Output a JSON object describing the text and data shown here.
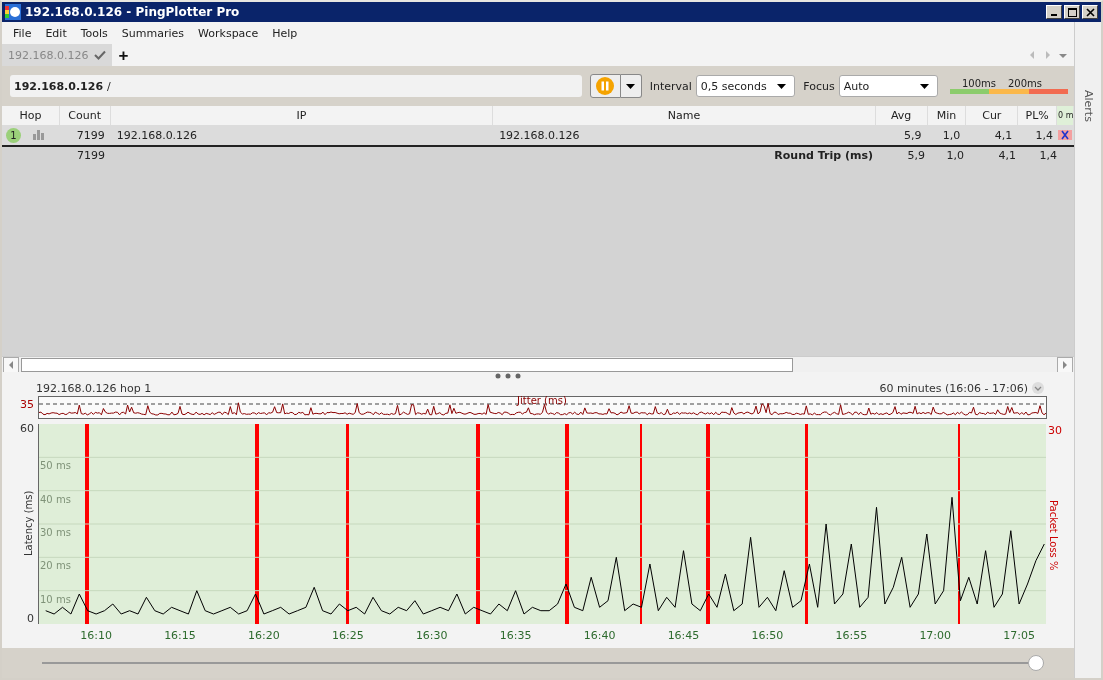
{
  "window": {
    "title": "192.168.0.126 - PingPlotter Pro"
  },
  "menu": [
    "File",
    "Edit",
    "Tools",
    "Summaries",
    "Workspace",
    "Help"
  ],
  "tabs": [
    {
      "label": "192.168.0.126",
      "selected": true
    }
  ],
  "new_tab": "+",
  "toolbar": {
    "target": "192.168.0.126",
    "target_suffix": "/",
    "interval_label": "Interval",
    "interval": "0,5 seconds",
    "focus_label": "Focus",
    "focus": "Auto",
    "scale_labels": [
      "100ms",
      "200ms"
    ]
  },
  "table": {
    "columns": [
      "Hop",
      "Count",
      "IP",
      "Name",
      "Avg",
      "Min",
      "Cur",
      "PL%",
      "0 m"
    ],
    "rows": [
      {
        "hop": "1",
        "count": "7199",
        "ip": "192.168.0.126",
        "name": "192.168.0.126",
        "avg": "5,9",
        "min": "1,0",
        "cur": "4,1",
        "pl": "1,4"
      }
    ],
    "summary": {
      "count": "7199",
      "label": "Round Trip (ms)",
      "avg": "5,9",
      "min": "1,0",
      "cur": "4,1",
      "pl": "1,4"
    }
  },
  "graph": {
    "title": "192.168.0.126 hop 1",
    "range": "60 minutes (16:06 - 17:06)",
    "jitter_label": "Jitter (ms)",
    "jitter_max": "35",
    "y_max": "60",
    "y_min": "0",
    "loss_max": "30",
    "loss_axis_label": "Packet Loss %",
    "chart_data": {
      "type": "line",
      "ylabel": "Latency (ms)",
      "ylim": [
        0,
        60
      ],
      "grid": true,
      "categories": [
        null,
        null,
        null,
        null,
        null,
        null,
        "16:10",
        null,
        null,
        null,
        null,
        null,
        null,
        null,
        null,
        null,
        "16:15",
        null,
        null,
        null,
        null,
        null,
        null,
        null,
        null,
        null,
        "16:20",
        null,
        null,
        null,
        null,
        null,
        null,
        null,
        null,
        null,
        "16:25",
        null,
        null,
        null,
        null,
        null,
        null,
        null,
        null,
        null,
        "16:30",
        null,
        null,
        null,
        null,
        null,
        null,
        null,
        null,
        null,
        "16:35",
        null,
        null,
        null,
        null,
        null,
        null,
        null,
        null,
        null,
        "16:40",
        null,
        null,
        null,
        null,
        null,
        null,
        null,
        null,
        null,
        "16:45",
        null,
        null,
        null,
        null,
        null,
        null,
        null,
        null,
        null,
        "16:50",
        null,
        null,
        null,
        null,
        null,
        null,
        null,
        null,
        null,
        "16:55",
        null,
        null,
        null,
        null,
        null,
        null,
        null,
        null,
        null,
        "17:00",
        null,
        null,
        null,
        null,
        null,
        null,
        null,
        null,
        null,
        "17:05",
        null,
        null,
        null
      ],
      "series": [
        {
          "color": "#000000",
          "values": [
            4,
            3,
            5,
            3,
            9,
            4,
            3,
            4,
            6,
            3,
            4,
            3,
            8,
            4,
            3,
            5,
            4,
            3,
            10,
            4,
            3,
            4,
            5,
            3,
            4,
            9,
            3,
            4,
            5,
            3,
            4,
            5,
            11,
            4,
            3,
            6,
            4,
            5,
            3,
            8,
            4,
            3,
            5,
            4,
            7,
            3,
            4,
            5,
            4,
            9,
            3,
            5,
            4,
            3,
            6,
            4,
            10,
            3,
            5,
            4,
            4,
            6,
            12,
            5,
            4,
            14,
            5,
            7,
            20,
            4,
            6,
            5,
            18,
            4,
            8,
            5,
            22,
            6,
            4,
            9,
            5,
            15,
            4,
            6,
            26,
            5,
            8,
            4,
            16,
            5,
            7,
            18,
            5,
            30,
            6,
            9,
            24,
            5,
            8,
            35,
            6,
            11,
            20,
            5,
            9,
            27,
            6,
            10,
            38,
            7,
            14,
            6,
            22,
            5,
            9,
            28,
            6,
            12,
            19,
            24
          ]
        }
      ],
      "yticks": [
        {
          "value": 10,
          "label": "10 ms"
        },
        {
          "value": 20,
          "label": "20 ms"
        },
        {
          "value": 30,
          "label": "30 ms"
        },
        {
          "value": 40,
          "label": "40 ms"
        },
        {
          "value": 50,
          "label": "50 ms"
        }
      ]
    }
  },
  "timeline": {
    "level": 1
  },
  "sidebar": {
    "label": "Alerts"
  }
}
